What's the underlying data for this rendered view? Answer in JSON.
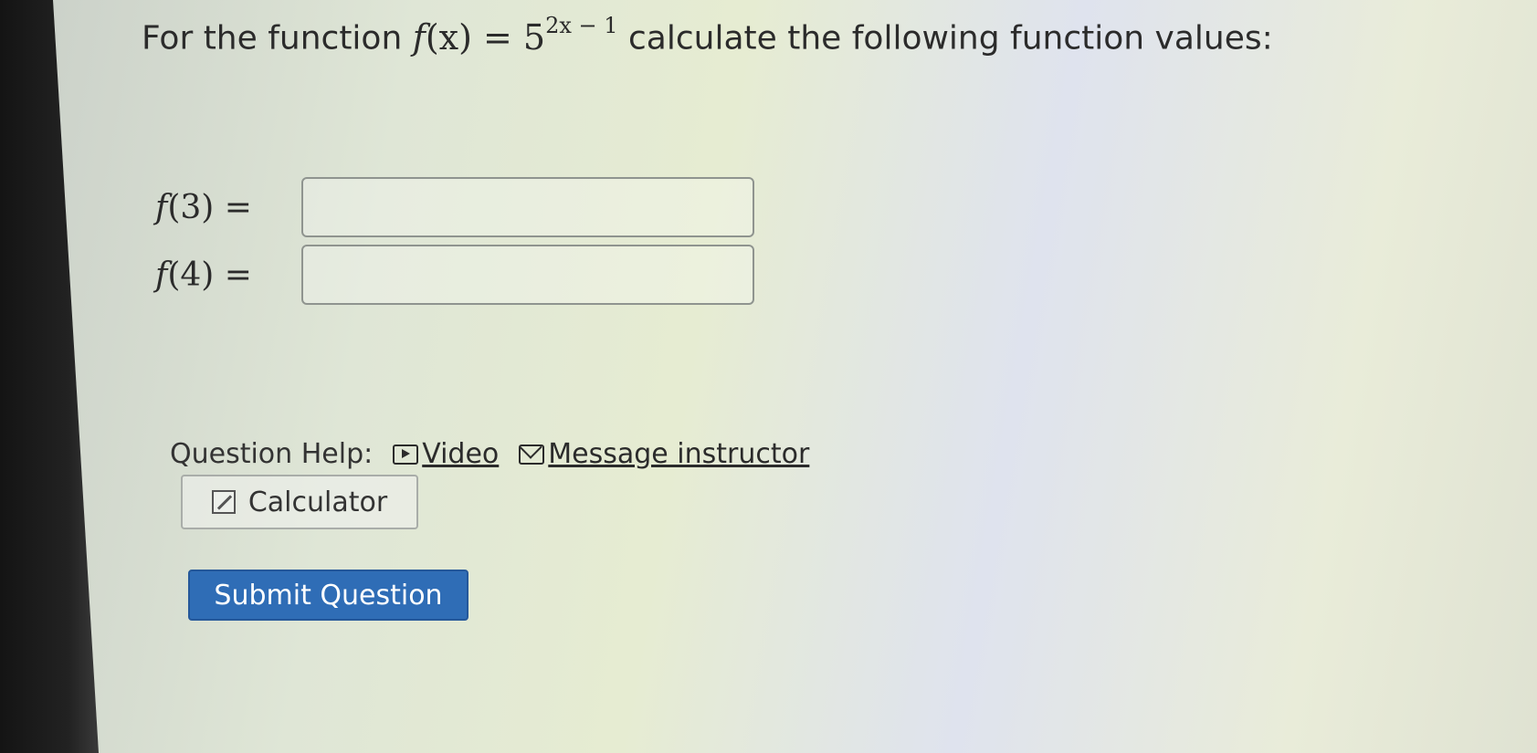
{
  "question": {
    "prefix": "For the function",
    "func_lhs": "f",
    "func_arg": "(x) = 5",
    "exponent": "2x − 1",
    "suffix": "calculate the following function values:"
  },
  "answers": [
    {
      "fn": "f",
      "arg": "(3) =",
      "value": ""
    },
    {
      "fn": "f",
      "arg": "(4) =",
      "value": ""
    }
  ],
  "help": {
    "label": "Question Help:",
    "video_label": "Video",
    "message_label": "Message instructor",
    "calculator_label": "Calculator"
  },
  "submit": {
    "label": "Submit Question",
    "color": "#2f6db6"
  },
  "icons": {
    "video": "video-icon",
    "message": "mail-icon",
    "calculator": "calculator-icon"
  }
}
